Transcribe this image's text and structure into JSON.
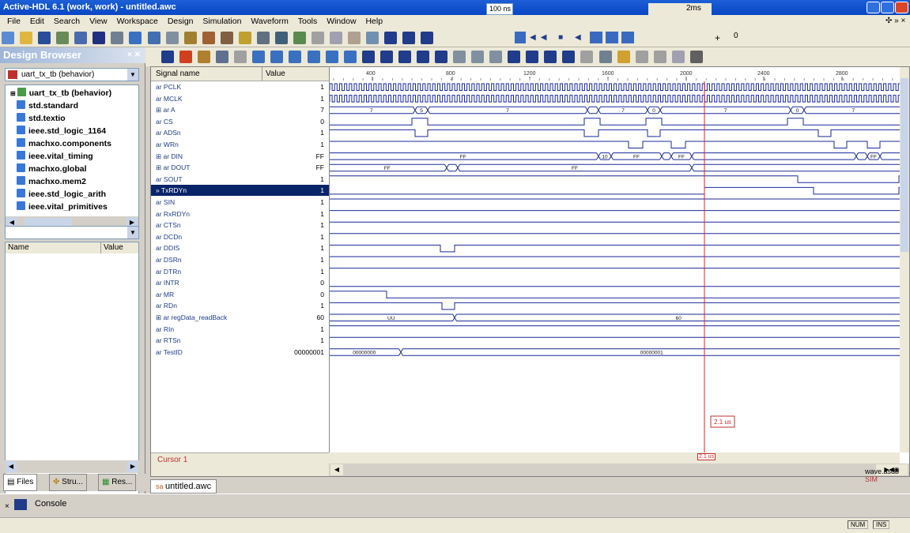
{
  "window": {
    "title": "Active-HDL 6.1 (work, work) - untitled.awc"
  },
  "menu": [
    "File",
    "Edit",
    "Search",
    "View",
    "Workspace",
    "Design",
    "Simulation",
    "Waveform",
    "Tools",
    "Window",
    "Help"
  ],
  "toolbar": {
    "time_step": "100 ns",
    "sim_time": "2ms",
    "sim_plus": "+",
    "sim_zero": "0"
  },
  "design_browser": {
    "title": "Design Browser",
    "top_unit": "uart_tx_tb (behavior)",
    "items": [
      "uart_tx_tb (behavior)",
      "std.standard",
      "std.textio",
      "ieee.std_logic_1164",
      "machxo.components",
      "ieee.vital_timing",
      "machxo.global",
      "machxo.mem2",
      "ieee.std_logic_arith",
      "ieee.vital_primitives"
    ],
    "columns": {
      "name": "Name",
      "value": "Value"
    },
    "tabs": [
      "Files",
      "Stru...",
      "Res..."
    ]
  },
  "waveform": {
    "header": {
      "signal_name": "Signal name",
      "value": "Value"
    },
    "ticks": [
      "400",
      "800",
      "1200",
      "1600",
      "2000",
      "2400",
      "2800"
    ],
    "signals": [
      {
        "name": "PCLK",
        "value": "1"
      },
      {
        "name": "MCLK",
        "value": "1"
      },
      {
        "name": "A",
        "value": "7"
      },
      {
        "name": "CS",
        "value": "0"
      },
      {
        "name": "ADSn",
        "value": "1"
      },
      {
        "name": "WRn",
        "value": "1"
      },
      {
        "name": "DIN",
        "value": "FF"
      },
      {
        "name": "DOUT",
        "value": "FF"
      },
      {
        "name": "SOUT",
        "value": "1"
      },
      {
        "name": "TxRDYn",
        "value": "1"
      },
      {
        "name": "SIN",
        "value": "1"
      },
      {
        "name": "RxRDYn",
        "value": "1"
      },
      {
        "name": "CTSn",
        "value": "1"
      },
      {
        "name": "DCDn",
        "value": "1"
      },
      {
        "name": "DDIS",
        "value": "1"
      },
      {
        "name": "DSRn",
        "value": "1"
      },
      {
        "name": "DTRn",
        "value": "1"
      },
      {
        "name": "INTR",
        "value": "0"
      },
      {
        "name": "MR",
        "value": "0"
      },
      {
        "name": "RDn",
        "value": "1"
      },
      {
        "name": "regData_readBack",
        "value": "60"
      },
      {
        "name": "RIn",
        "value": "1"
      },
      {
        "name": "RTSn",
        "value": "1"
      },
      {
        "name": "TestID",
        "value": "00000001"
      }
    ],
    "bus_labels": {
      "A_a": "7",
      "A_b": "5",
      "A_c": "7",
      "A_d": "0",
      "A_e": "7",
      "A_f": "0",
      "A_g": "7",
      "A_h": "0",
      "A_i": "7",
      "DIN_a": "FF",
      "DIN_b": "10",
      "DIN_c": "FF",
      "DIN_d": "35",
      "DIN_e": "FF",
      "DIN_f": "FF",
      "DOUT_a": "FF",
      "DOUT_b": "FF",
      "REG_a": "UU",
      "REG_b": "60",
      "TID_a": "00000000",
      "TID_b": "00000001"
    },
    "cursor": {
      "label": "Cursor 1",
      "time": "2.1 us"
    },
    "tab": "untitled.awc",
    "db_file": "wave.asdb",
    "db_sim": "SIM"
  },
  "console": {
    "label": "Console"
  },
  "status": {
    "num": "NUM",
    "ins": "INS"
  }
}
